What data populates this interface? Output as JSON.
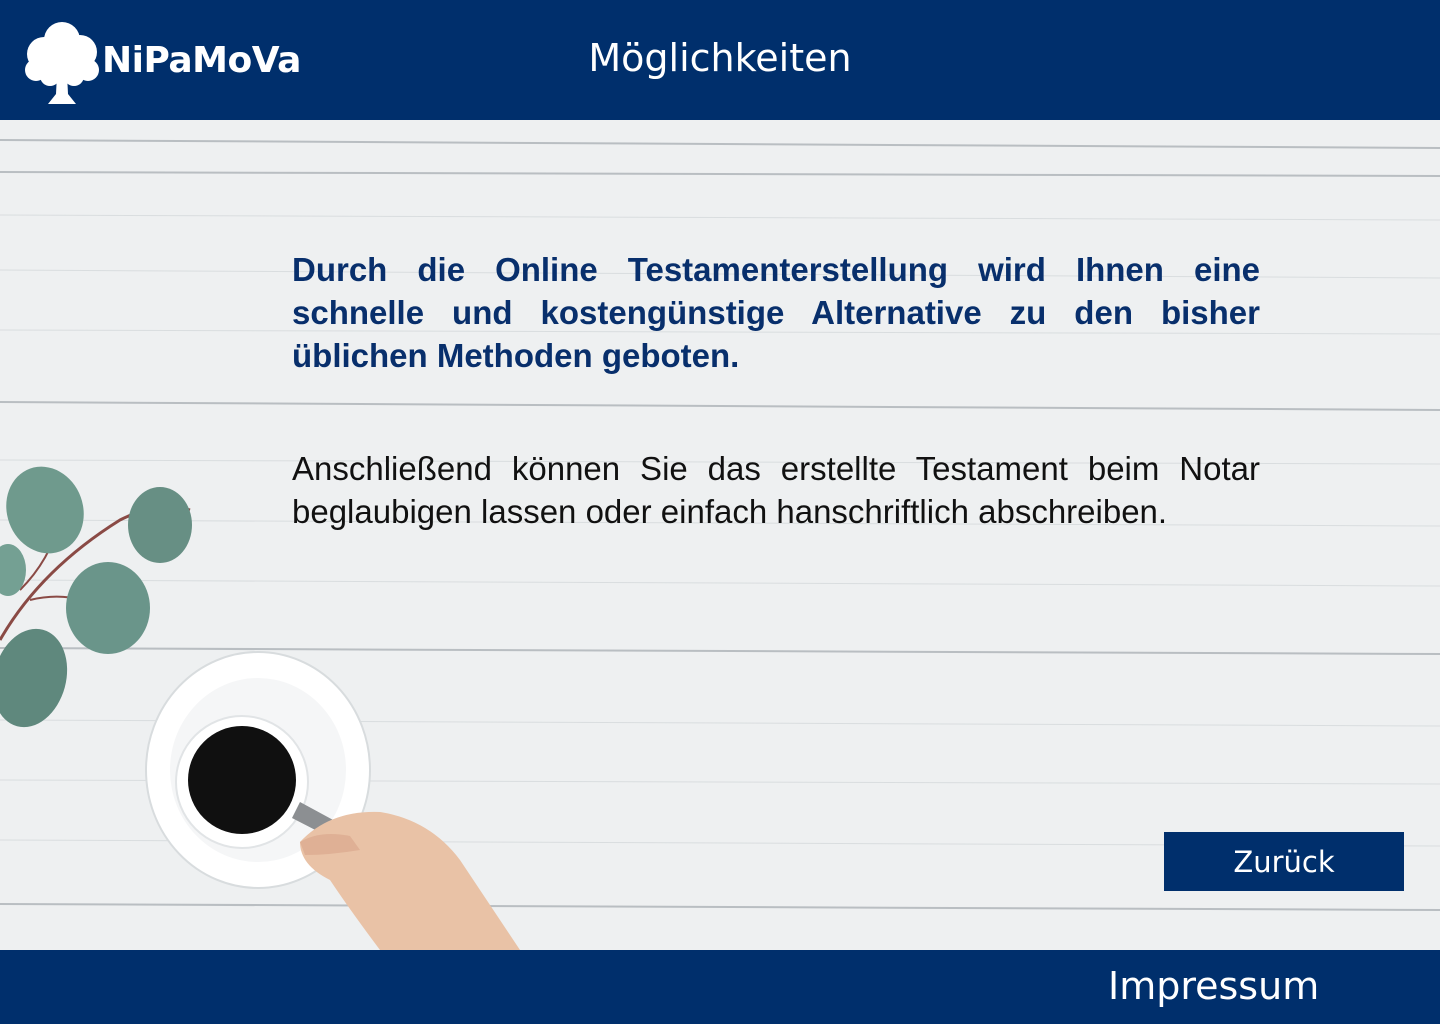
{
  "header": {
    "logo_text": "NiPaMoVa",
    "logo_icon": "tree-icon",
    "title": "Möglichkeiten"
  },
  "main": {
    "intro": "Durch die Online Testamenterstellung wird Ihnen eine schnelle und kostengünstige Alternative zu den bisher üblichen Methoden geboten.",
    "body": "Anschließend können Sie das erstellte Testament beim Notar beglaubigen lassen oder einfach hanschriftlich abschreiben.",
    "back_label": "Zurück"
  },
  "footer": {
    "impressum_label": "Impressum"
  },
  "colors": {
    "primary": "#002f6c",
    "intro_text": "#082f6c",
    "background": "#f0f2f3"
  }
}
